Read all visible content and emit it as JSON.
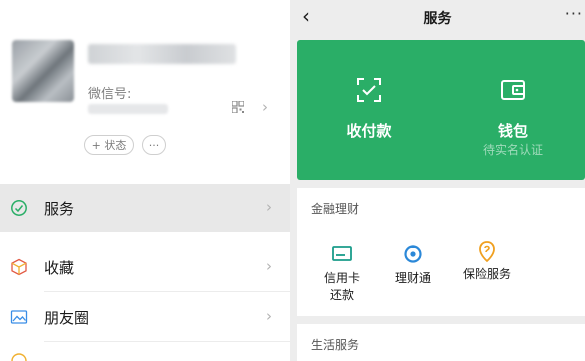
{
  "me": {
    "wechat_id_label": "微信号:",
    "status_label": "+ 状态",
    "more_label": "···",
    "menu": [
      {
        "label": "服务",
        "icon": "services-icon"
      },
      {
        "label": "收藏",
        "icon": "favorites-icon"
      },
      {
        "label": "朋友圈",
        "icon": "moments-icon"
      }
    ]
  },
  "services": {
    "header": {
      "back": "‹",
      "title": "服务",
      "more": "···"
    },
    "wallet_panel": {
      "pay": {
        "label": "收付款",
        "icon": "scan-pay-icon"
      },
      "wallet": {
        "label": "钱包",
        "sub": "待实名认证",
        "icon": "wallet-icon"
      }
    },
    "finance": {
      "title": "金融理财",
      "items": [
        {
          "label": "信用卡还款",
          "icon": "credit-card-icon",
          "color": "#1a9c8a"
        },
        {
          "label": "理财通",
          "icon": "licaitong-icon",
          "color": "#2b88d8"
        },
        {
          "label": "保险服务",
          "icon": "insurance-icon",
          "color": "#f0a020"
        }
      ]
    },
    "life": {
      "title": "生活服务"
    }
  },
  "colors": {
    "accent_green": "#2aae67",
    "background": "#ededed"
  }
}
